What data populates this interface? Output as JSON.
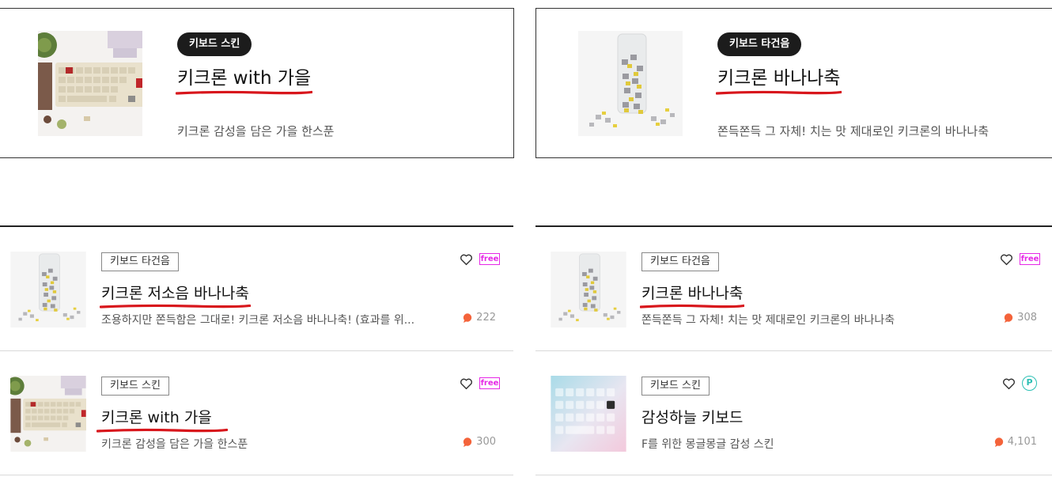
{
  "featured": [
    {
      "tag": "키보드 스킨",
      "title": "키크론 with 가을",
      "desc": "키크론 감성을 담은 가을 한스푼"
    },
    {
      "tag": "키보드 타건음",
      "title": "키크론 바나나축",
      "desc": "쫀득쫀득 그 자체! 치는 맛 제대로인 키크론의 바나나축"
    }
  ],
  "list_left": [
    {
      "tag": "키보드 타건음",
      "title": "키크론 저소음 바나나축",
      "desc": "조용하지만 쫀득함은 그대로! 키크론 저소음 바나나축! (효과를 위...",
      "badge": "free",
      "comments": "222"
    },
    {
      "tag": "키보드 스킨",
      "title": "키크론 with 가을",
      "desc": "키크론 감성을 담은 가을 한스푼",
      "badge": "free",
      "comments": "300"
    }
  ],
  "list_right": [
    {
      "tag": "키보드 타건음",
      "title": "키크론 바나나축",
      "desc": "쫀득쫀득 그 자체! 치는 맛 제대로인 키크론의 바나나축",
      "badge": "free",
      "comments": "308"
    },
    {
      "tag": "키보드 스킨",
      "title": "감성하늘 키보드",
      "desc": "F를 위한 몽글몽글 감성 스킨",
      "badge": "P",
      "comments": "4,101"
    }
  ],
  "colors": {
    "underline": "#d8161c",
    "free_badge": "#e628e6",
    "premium_badge": "#2bbfb4",
    "comment_icon": "#f4633a"
  },
  "icons": {
    "like": "heart-outline-icon",
    "comments": "speech-bubble-icon",
    "premium": "p-circle-icon"
  }
}
